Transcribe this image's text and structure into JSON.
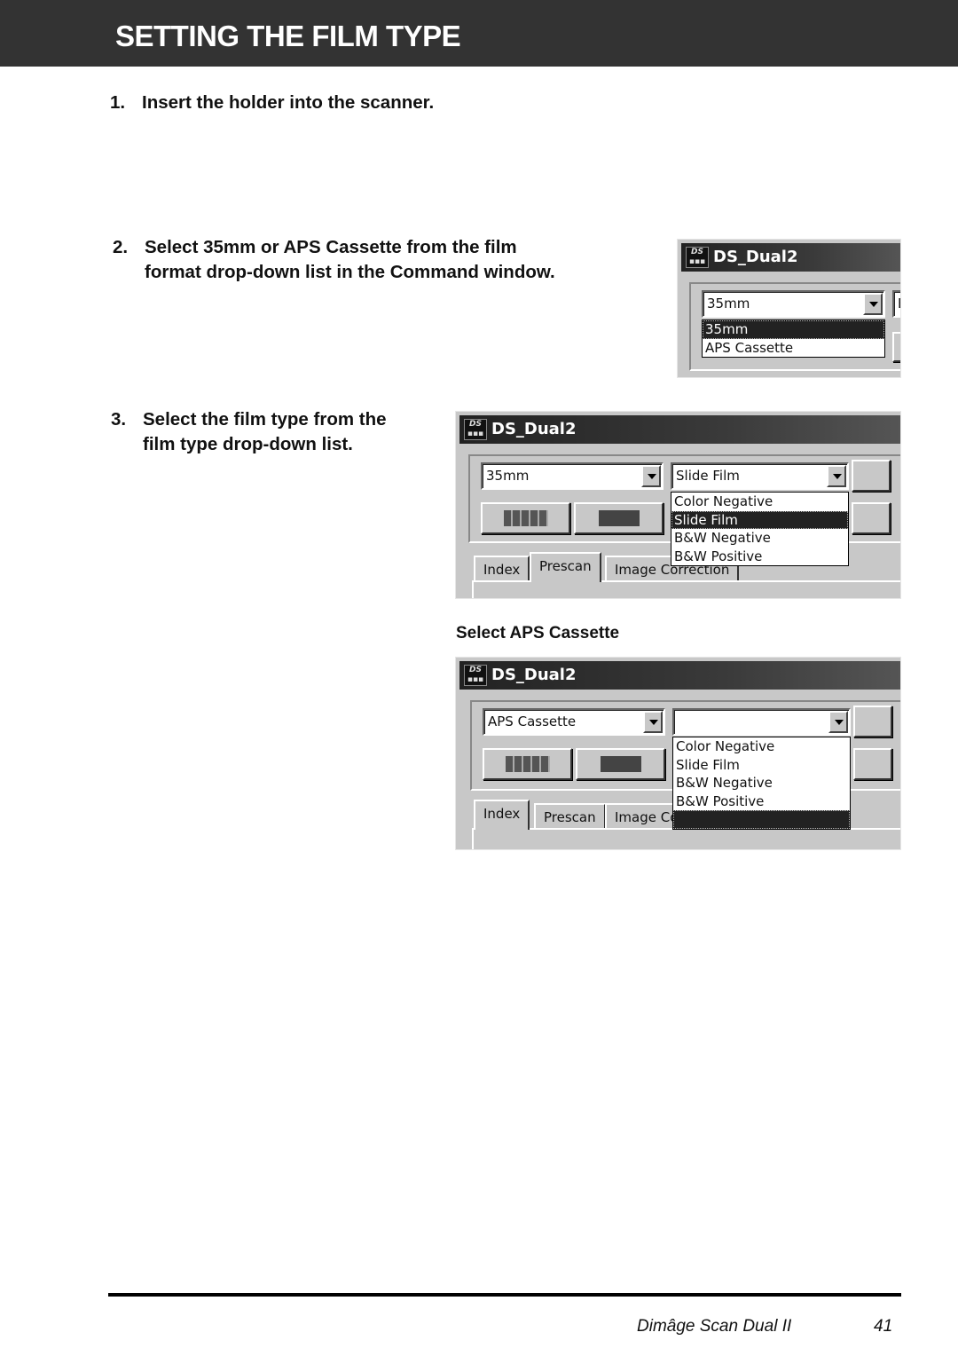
{
  "header": {
    "title": "SETTING THE FILM TYPE"
  },
  "steps": [
    {
      "number": "1.",
      "text": "Insert the holder into the scanner."
    },
    {
      "number": "2.",
      "text_line1": "Select 35mm or APS Cassette from the film",
      "text_line2": "format drop-down list in the Command window."
    },
    {
      "number": "3.",
      "text_line1": "Select the film type from the",
      "text_line2": "film type drop-down list."
    }
  ],
  "caption_aps": "Select APS Cassette",
  "window1": {
    "title": "DS_Dual2",
    "format_value": "35mm",
    "format_options": [
      "35mm",
      "APS Cassette"
    ],
    "selected_option": "35mm",
    "partial_right": "E"
  },
  "window2": {
    "title": "DS_Dual2",
    "format_value": "35mm",
    "film_type_value": "Slide Film",
    "film_type_options": [
      "Color Negative",
      "Slide Film",
      "B&W Negative",
      "B&W Positive"
    ],
    "selected_option": "Slide Film",
    "tabs": [
      "Index",
      "Prescan",
      "Image Correction"
    ],
    "active_tab": "Prescan"
  },
  "window3": {
    "title": "DS_Dual2",
    "format_value": "APS Cassette",
    "film_type_value": "",
    "film_type_options": [
      "Color Negative",
      "Slide Film",
      "B&W Negative",
      "B&W Positive",
      ""
    ],
    "selected_option": "",
    "tabs": [
      "Index",
      "Prescan",
      "Image Co"
    ],
    "active_tab": "Index"
  },
  "logo_text": "DS",
  "footer": {
    "product": "Dimâge Scan Dual II",
    "page": "41"
  }
}
